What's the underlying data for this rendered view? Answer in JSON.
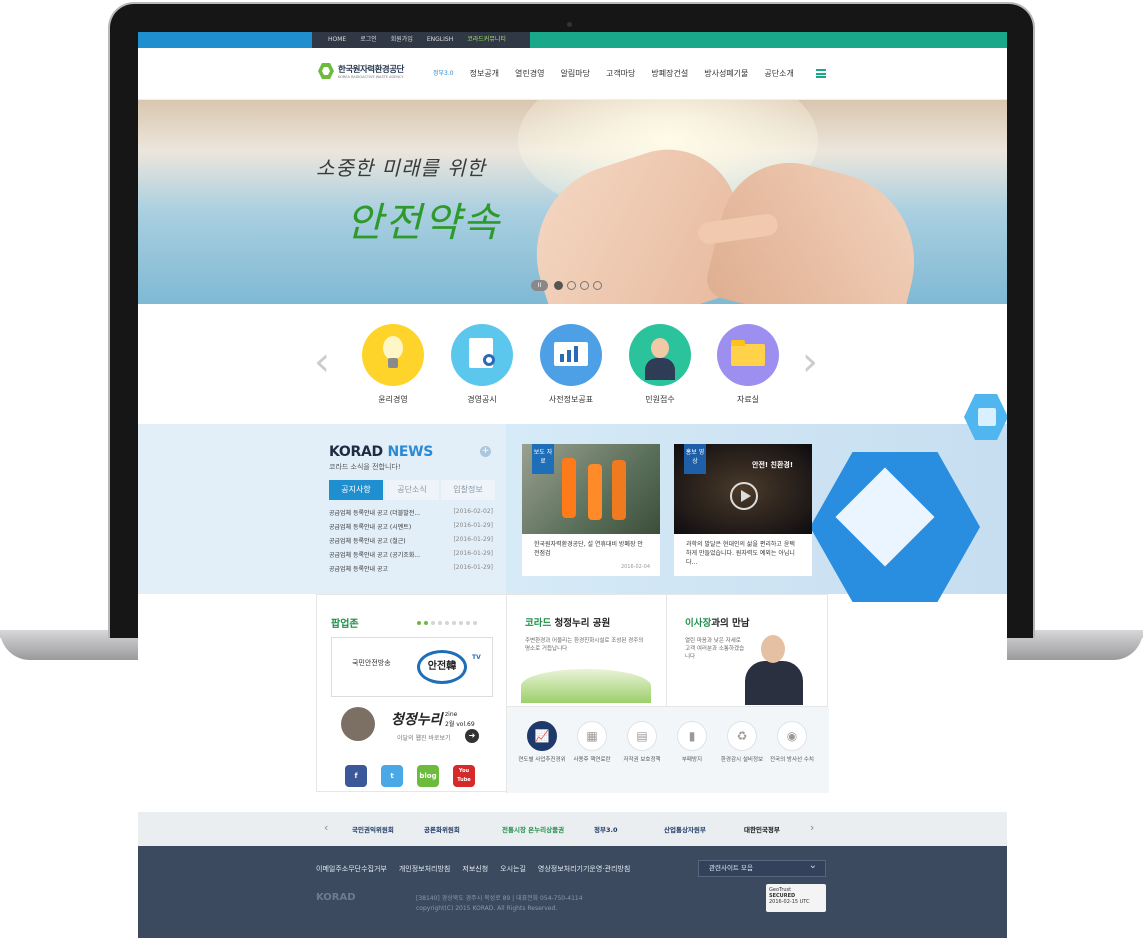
{
  "topbar": {
    "links": [
      "HOME",
      "로그인",
      "회원가입",
      "ENGLISH",
      "코라드커뮤니티"
    ]
  },
  "header": {
    "logo_ko": "한국원자력환경공단",
    "logo_en": "KOREA RADIOACTIVE WASTE AGENCY",
    "gov_label": "정부3.0",
    "nav": [
      "정보공개",
      "열린경영",
      "알림마당",
      "고객마당",
      "방폐장건설",
      "방사성폐기물",
      "공단소개"
    ]
  },
  "hero": {
    "line1": "소중한 미래를 위한",
    "line2": "안전약속",
    "pause": "II"
  },
  "quick": {
    "prev": "‹",
    "next": "›",
    "items": [
      "윤리경영",
      "경영공시",
      "사전정보공표",
      "민원접수",
      "자료실"
    ]
  },
  "news": {
    "title_a": "KORAD",
    "title_b": "NEWS",
    "subtitle": "코라드 소식을 전합니다!",
    "plus": "+",
    "tabs": [
      "공지사항",
      "공단소식",
      "입찰정보"
    ],
    "items": [
      {
        "text": "공급업체 등록안내 공고 (더블발전...",
        "date": "[2016-02-02]"
      },
      {
        "text": "공급업체 등록안내 공고 (시멘트)",
        "date": "[2016-01-29]"
      },
      {
        "text": "공급업체 등록안내 공고 (철근)",
        "date": "[2016-01-29]"
      },
      {
        "text": "공급업체 등록안내 공고 (공기조화...",
        "date": "[2016-01-29]"
      },
      {
        "text": "공급업체 등록안내 공고",
        "date": "[2016-01-29]"
      }
    ],
    "card1": {
      "badge": "보도 자료",
      "text": "한국원자력환경공단, 설 연휴대비 방폐장 안전점검",
      "date": "2016-02-04"
    },
    "card2": {
      "badge": "홍보 영상",
      "overlay": "안전! 친환경!",
      "text": "과학의 발달은 현대인의 삶을 편리하고 윤택하게 만들었습니다. 원자력도 예외는 아닙니다..."
    }
  },
  "popup": {
    "title": "팝업존",
    "box_text": "국민안전방송",
    "tv_label": "안전韓",
    "tv_small": "TV",
    "zine_title": "청정누리",
    "zine_label": "zine",
    "zine_vol": "2월 vol.69",
    "zine_link": "이달의 웹진 바로보기",
    "zine_go": "➜",
    "social": [
      "f",
      "t",
      "blog",
      "You Tube"
    ]
  },
  "park": {
    "title_a": "코라드",
    "title_b": " 청정누리 공원",
    "text": "주변환경과 어울리는 환경친화시설로 조성된 경주의 명소로 거듭납니다"
  },
  "ceo": {
    "title_a": "이사장",
    "title_b": "과의 만남",
    "text": "열린 마음과 낮은 자세로 고객 여러분과 소통하겠습니다"
  },
  "icons": [
    {
      "icon": "chart-icon",
      "glyph": "📈",
      "label": "연도별 사업추진경위"
    },
    {
      "icon": "factory-icon",
      "glyph": "▦",
      "label": "사용후 핵연료란"
    },
    {
      "icon": "book-icon",
      "glyph": "▤",
      "label": "저작권 보호정책"
    },
    {
      "icon": "tie-icon",
      "glyph": "▮",
      "label": "부패방지"
    },
    {
      "icon": "recycle-icon",
      "glyph": "♻",
      "label": "환경감시 설비정보"
    },
    {
      "icon": "location-icon",
      "glyph": "◉",
      "label": "전국의 방사선 수치"
    }
  ],
  "partners": {
    "prev": "‹",
    "next": "›",
    "items": [
      "국민권익위원회",
      "공론화위원회",
      "전통시장 온누리상품권",
      "정부3.0",
      "산업통상자원부",
      "대한민국정부"
    ]
  },
  "footer": {
    "links": [
      "이메일주소무단수집거부",
      "개인정보처리방침",
      "저보신청",
      "오시는길",
      "영상정보처리기기운영·관리방침"
    ],
    "select": "관련사이트 모음",
    "logo": "KORAD",
    "address": "[38140] 경상북도 경주시 북성로 89 | 대표전화 054-750-4114",
    "copyright": "copyright(C) 2015 KORAD. All Rights Reserved.",
    "cert_top": "GeoTrust",
    "cert_bottom": "SECURED",
    "cert_date": "2016-02-15 UTC"
  }
}
